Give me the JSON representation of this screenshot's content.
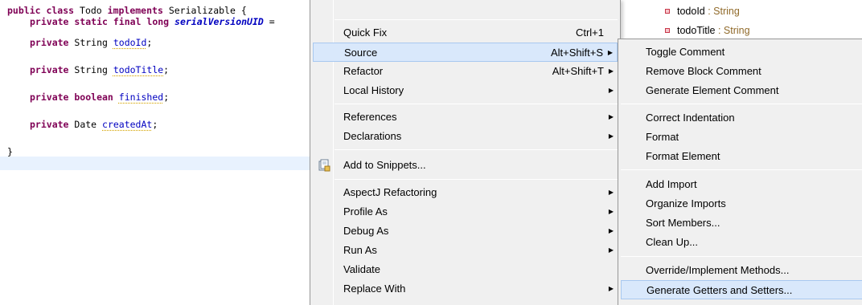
{
  "editor": {
    "lines": [
      {
        "kw1": "public class",
        "t1": " Todo ",
        "kw2": "implements",
        "t2": " Serializable {"
      },
      {
        "kw1": "private static final long",
        "t1": " ",
        "field": "serialVersionUID",
        "t2": " ="
      },
      {
        "kw1": "private",
        "t1": " String ",
        "field": "todoId",
        "t2": ";"
      },
      {
        "kw1": "private",
        "t1": " String ",
        "field": "todoTitle",
        "t2": ";"
      },
      {
        "kw1": "private boolean",
        "t1": " ",
        "field": "finished",
        "t2": ";"
      },
      {
        "kw1": "private",
        "t1": " Date ",
        "field": "createdAt",
        "t2": ";"
      },
      {
        "t1": "}"
      }
    ]
  },
  "outline": {
    "items": [
      {
        "name": "todoId",
        "type": " : String"
      },
      {
        "name": "todoTitle",
        "type": " : String"
      }
    ]
  },
  "context_menu": {
    "items": [
      {
        "label": "Quick Fix",
        "accel": "Ctrl+1"
      },
      {
        "label": "Source",
        "accel": "Alt+Shift+S"
      },
      {
        "label": "Refactor",
        "accel": "Alt+Shift+T"
      },
      {
        "label": "Local History"
      },
      {
        "label": "References"
      },
      {
        "label": "Declarations"
      },
      {
        "label": "Add to Snippets...",
        "icon": "snippet-icon"
      },
      {
        "label": "AspectJ Refactoring"
      },
      {
        "label": "Profile As"
      },
      {
        "label": "Debug As"
      },
      {
        "label": "Run As"
      },
      {
        "label": "Validate"
      },
      {
        "label": "Replace With"
      }
    ]
  },
  "source_menu": {
    "items": [
      {
        "label": "Toggle Comment"
      },
      {
        "label": "Remove Block Comment"
      },
      {
        "label": "Generate Element Comment"
      },
      {
        "label": "Correct Indentation"
      },
      {
        "label": "Format"
      },
      {
        "label": "Format Element"
      },
      {
        "label": "Add Import"
      },
      {
        "label": "Organize Imports"
      },
      {
        "label": "Sort Members..."
      },
      {
        "label": "Clean Up..."
      },
      {
        "label": "Override/Implement Methods..."
      },
      {
        "label": "Generate Getters and Setters..."
      }
    ]
  },
  "colors": {
    "menu_bg": "#f0f0f0",
    "highlight_bg": "#d9e8fb",
    "highlight_border": "#a8c8f0",
    "keyword": "#7f0055",
    "field": "#0000c0",
    "current_line": "#e8f2fe"
  }
}
